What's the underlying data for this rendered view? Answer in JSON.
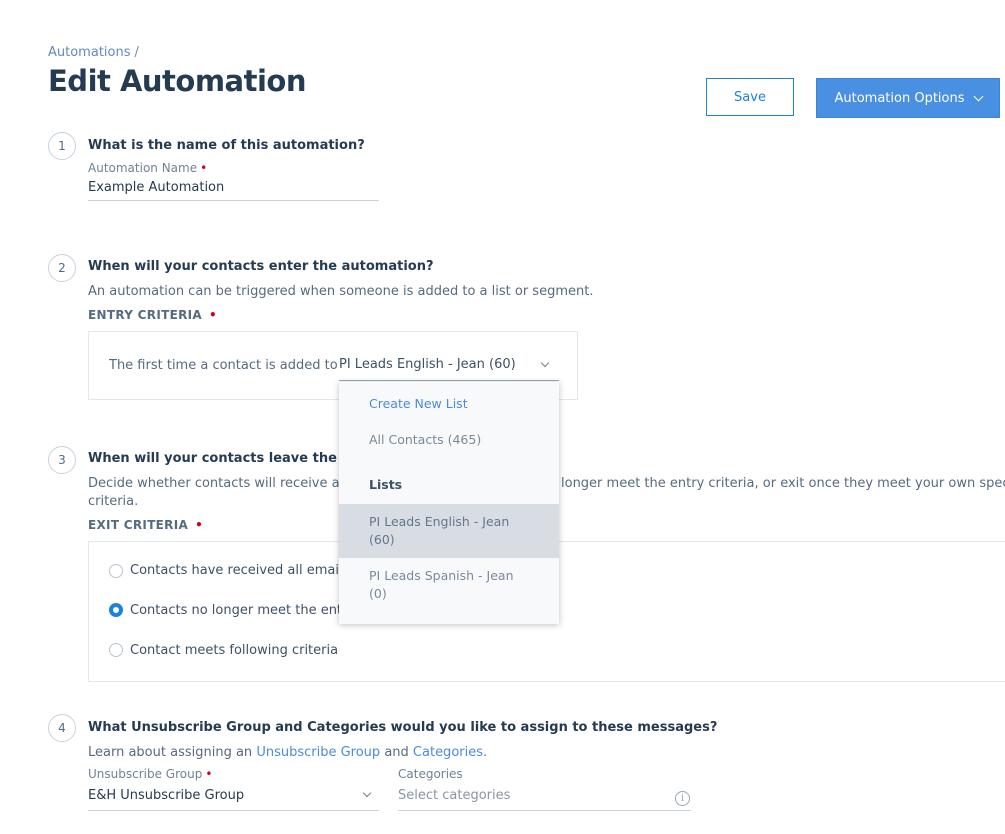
{
  "breadcrumb": {
    "root": "Automations",
    "separator": "/"
  },
  "page": {
    "title": "Edit Automation"
  },
  "header": {
    "save_label": "Save",
    "options_label": "Automation Options"
  },
  "steps": {
    "s1": {
      "number": "1",
      "question": "What is the name of this automation?",
      "field_label": "Automation Name",
      "field_value": "Example Automation"
    },
    "s2": {
      "number": "2",
      "question": "When will your contacts enter the automation?",
      "help": "An automation can be triggered when someone is added to a list or segment.",
      "criteria_label": "ENTRY CRITERIA",
      "trigger_text": "The first time a contact is added to",
      "selected_list": "PI Leads English - Jean (60)"
    },
    "s3": {
      "number": "3",
      "question": "When will your contacts leave the automa",
      "help_left": "Decide whether contacts will receive all en",
      "help_right": "longer meet the entry criteria, or exit once they meet your own specified",
      "help_line2": "criteria.",
      "criteria_label": "EXIT CRITERIA",
      "options": [
        {
          "label": "Contacts have received all emails in",
          "selected": false
        },
        {
          "label": "Contacts no longer meet the entry c",
          "selected": true
        },
        {
          "label": "Contact meets following criteria",
          "selected": false
        }
      ]
    },
    "s4": {
      "number": "4",
      "question": "What Unsubscribe Group and Categories would you like to assign to these messages?",
      "help_prefix": "Learn about assigning an",
      "help_link1": "Unsubscribe Group",
      "help_and": "and",
      "help_link2": "Categories.",
      "unsub_label": "Unsubscribe Group",
      "unsub_value": "E&H Unsubscribe Group",
      "categories_label": "Categories",
      "categories_placeholder": "Select categories",
      "info_glyph": "i"
    }
  },
  "dropdown": {
    "create_new": "Create New List",
    "all_contacts": "All Contacts (465)",
    "lists_heading": "Lists",
    "items": [
      {
        "line1": "PI Leads English - Jean",
        "line2": "(60)",
        "selected": true
      },
      {
        "line1": "PI Leads Spanish - Jean",
        "line2": "(0)",
        "selected": false
      }
    ]
  },
  "colors": {
    "primary": "#1a82e2",
    "button_fill": "#4a90e2",
    "required": "#d0021b",
    "heading": "#253b52"
  }
}
